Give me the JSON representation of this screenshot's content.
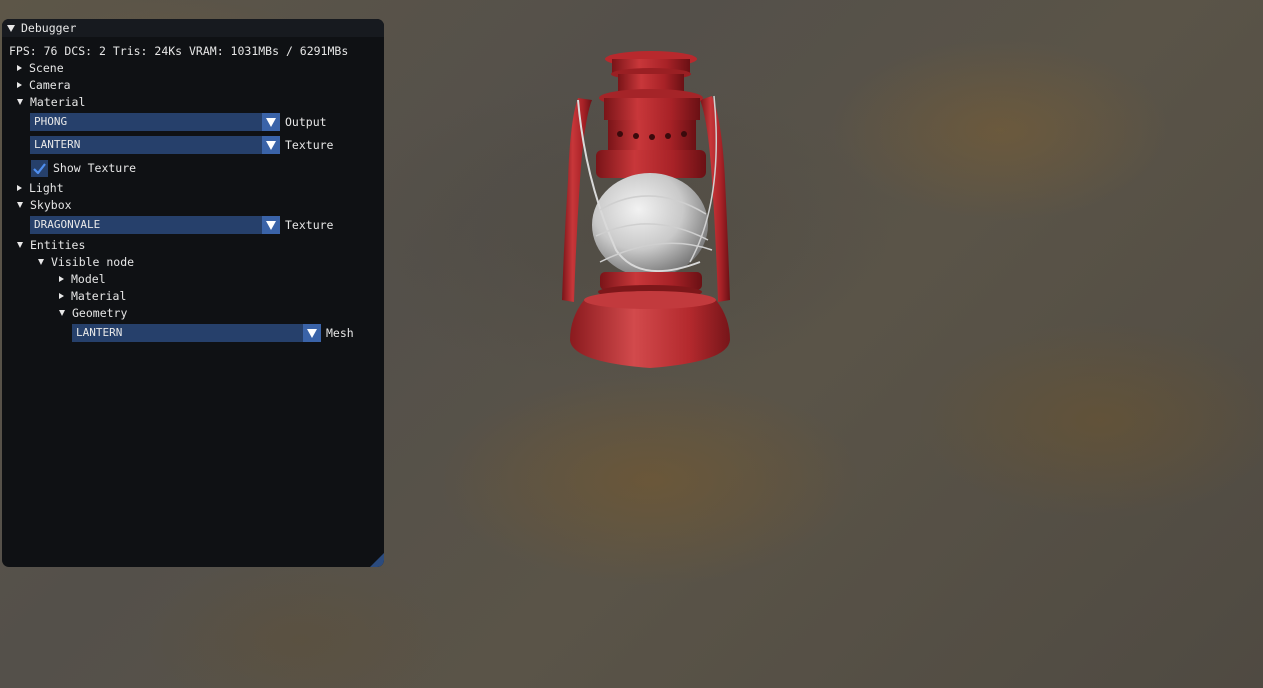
{
  "window": {
    "title": "Debugger",
    "stats": "FPS: 76 DCS: 2 Tris: 24Ks  VRAM: 1031MBs / 6291MBs"
  },
  "tree": {
    "scene": "Scene",
    "camera": "Camera",
    "material": {
      "label": "Material",
      "output_value": "PHONG",
      "output_label": "Output",
      "texture_value": "LANTERN",
      "texture_label": "Texture",
      "show_texture_label": "Show Texture",
      "show_texture_checked": true
    },
    "light": "Light",
    "skybox": {
      "label": "Skybox",
      "texture_value": "DRAGONVALE",
      "texture_label": "Texture"
    },
    "entities": {
      "label": "Entities",
      "visible_node": "Visible node",
      "model": "Model",
      "material": "Material",
      "geometry": {
        "label": "Geometry",
        "mesh_value": "LANTERN",
        "mesh_label": "Mesh"
      }
    }
  },
  "colors": {
    "panel_bg": "#0f1114",
    "combo_bg": "#26406b",
    "combo_arrow_bg": "#3a63a8",
    "accent": "#3a7bd5",
    "lantern_red": "#b5262b"
  },
  "icons": {
    "collapse": "triangle-down-icon",
    "expand": "triangle-right-icon",
    "dropdown": "dropdown-arrow-icon",
    "check": "checkmark-icon",
    "resize": "resize-grip-icon"
  }
}
